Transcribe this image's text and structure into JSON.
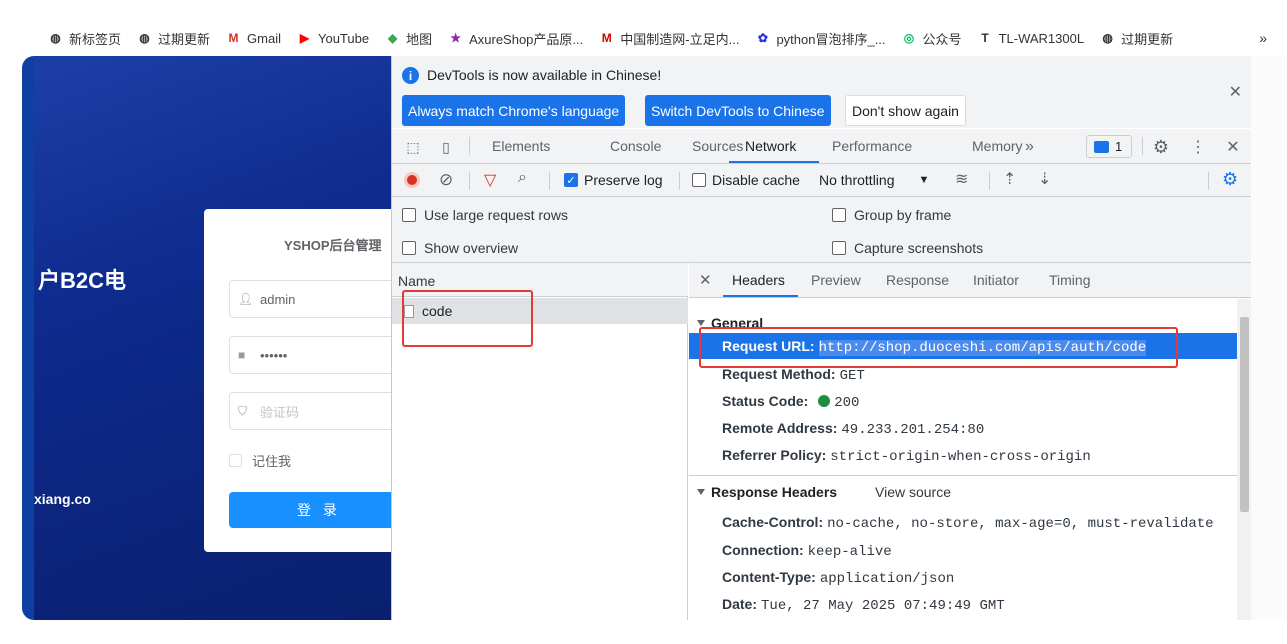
{
  "bookmarks": [
    {
      "label": "新标签页",
      "icon": "globe-icon"
    },
    {
      "label": "过期更新",
      "icon": "globe-icon"
    },
    {
      "label": "Gmail",
      "icon": "gmail-icon"
    },
    {
      "label": "YouTube",
      "icon": "youtube-icon"
    },
    {
      "label": "地图",
      "icon": "maps-icon"
    },
    {
      "label": "AxureShop产品原...",
      "icon": "axure-icon"
    },
    {
      "label": "中国制造网-立足内...",
      "icon": "made-in-china-icon"
    },
    {
      "label": "python冒泡排序_...",
      "icon": "baidu-icon"
    },
    {
      "label": "公众号",
      "icon": "wechat-icon"
    },
    {
      "label": "TL-WAR1300L",
      "icon": "tplink-icon"
    },
    {
      "label": "过期更新",
      "icon": "globe-icon"
    }
  ],
  "bookmarks_more": "»",
  "page": {
    "heading": "户B2C电",
    "site": "xiang.co",
    "login": {
      "title": "YSHOP后台管理",
      "username": "admin",
      "password": "••••••",
      "captcha_placeholder": "验证码",
      "remember": "记住我",
      "submit": "登 录"
    }
  },
  "devtools": {
    "notice": {
      "text": "DevTools is now available in Chinese!",
      "btn_match": "Always match Chrome's language",
      "btn_switch": "Switch DevTools to Chinese",
      "btn_dismiss": "Don't show again"
    },
    "tabs": [
      "Elements",
      "Console",
      "Sources",
      "Network",
      "Performance",
      "Memory"
    ],
    "active_tab": "Network",
    "more_tabs": "»",
    "issues_count": "1",
    "network": {
      "preserve_log": "Preserve log",
      "disable_cache": "Disable cache",
      "throttling": "No throttling",
      "options": {
        "large_rows": "Use large request rows",
        "overview": "Show overview",
        "group_by_frame": "Group by frame",
        "capture_screenshots": "Capture screenshots"
      },
      "name_header": "Name",
      "requests": [
        "code"
      ]
    },
    "detail": {
      "tabs": [
        "Headers",
        "Preview",
        "Response",
        "Initiator",
        "Timing"
      ],
      "general_title": "General",
      "general": [
        {
          "k": "Request URL:",
          "v": "http://shop.duoceshi.com/apis/auth/code"
        },
        {
          "k": "Request Method:",
          "v": "GET"
        },
        {
          "k": "Status Code:",
          "v": "200"
        },
        {
          "k": "Remote Address:",
          "v": "49.233.201.254:80"
        },
        {
          "k": "Referrer Policy:",
          "v": "strict-origin-when-cross-origin"
        }
      ],
      "response_title": "Response Headers",
      "view_source": "View source",
      "response": [
        {
          "k": "Cache-Control:",
          "v": "no-cache, no-store, max-age=0, must-revalidate"
        },
        {
          "k": "Connection:",
          "v": "keep-alive"
        },
        {
          "k": "Content-Type:",
          "v": "application/json"
        },
        {
          "k": "Date:",
          "v": "Tue, 27 May 2025 07:49:49 GMT"
        }
      ]
    }
  },
  "colors": {
    "accent": "#1a73e8",
    "highlight_box": "#e53935",
    "status_ok": "#1e8e3e",
    "page_bg": "#0d2a8c",
    "login_btn": "#1890ff"
  }
}
